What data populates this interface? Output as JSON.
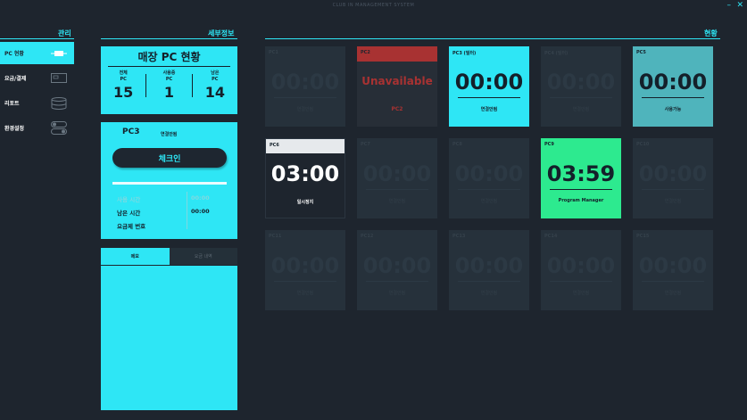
{
  "window": {
    "title": "CLUB IN MANAGEMENT SYSTEM",
    "minimize": "–",
    "close": "✕"
  },
  "sections": {
    "manage": "관리",
    "detail": "세부정보",
    "status": "현황"
  },
  "sidebar": {
    "items": [
      {
        "label": "PC 현황",
        "icon": "monitor-icon",
        "active": true
      },
      {
        "label": "요금/결제",
        "icon": "card-icon",
        "active": false
      },
      {
        "label": "리포트",
        "icon": "database-icon",
        "active": false
      },
      {
        "label": "환경설정",
        "icon": "toggle-icon",
        "active": false
      }
    ]
  },
  "summary": {
    "title": "매장 PC 현황",
    "stats": [
      {
        "label": "전체\nPC",
        "value": "15"
      },
      {
        "label": "사용중\nPC",
        "value": "1"
      },
      {
        "label": "남은\nPC",
        "value": "14"
      }
    ]
  },
  "selected": {
    "name": "PC3",
    "status": "연결안됨",
    "checkin_label": "체크인",
    "progress": 1.0,
    "rows": [
      {
        "label": "사용 시간",
        "value": "00:00"
      },
      {
        "label": "남은 시간",
        "value": "00:00"
      },
      {
        "label": "요금제 번호",
        "value": ""
      }
    ]
  },
  "tabs": [
    {
      "label": "메모",
      "active": true
    },
    {
      "label": "요금 내역",
      "active": false
    }
  ],
  "colors": {
    "accent": "#2ee6f5",
    "background": "#1e252e",
    "unavailable": "#a83232",
    "available": "#4fb4bc",
    "manager": "#2dea8f"
  },
  "pcs": [
    {
      "name": "PC1",
      "time": "00:00",
      "status": "연결안됨",
      "state": "off"
    },
    {
      "name": "PC2",
      "time": "",
      "status": "PC2",
      "state": "unavailable",
      "message": "Unavailable"
    },
    {
      "name": "PC3 (밀터)",
      "time": "00:00",
      "status": "연결안됨",
      "state": "selected"
    },
    {
      "name": "PC4 (밀터)",
      "time": "00:00",
      "status": "연결안됨",
      "state": "off"
    },
    {
      "name": "PC5",
      "time": "00:00",
      "status": "사용가능",
      "state": "available"
    },
    {
      "name": "PC6",
      "time": "03:00",
      "status": "일시정지",
      "state": "paused"
    },
    {
      "name": "PC7",
      "time": "00:00",
      "status": "연결안됨",
      "state": "off"
    },
    {
      "name": "PC8",
      "time": "00:00",
      "status": "연결안됨",
      "state": "off"
    },
    {
      "name": "PC9",
      "time": "03:59",
      "status": "Program Manager",
      "state": "manager"
    },
    {
      "name": "PC10",
      "time": "00:00",
      "status": "연결안됨",
      "state": "off"
    },
    {
      "name": "PC11",
      "time": "00:00",
      "status": "연결안됨",
      "state": "off"
    },
    {
      "name": "PC12",
      "time": "00:00",
      "status": "연결안됨",
      "state": "off"
    },
    {
      "name": "PC13",
      "time": "00:00",
      "status": "연결안됨",
      "state": "off"
    },
    {
      "name": "PC14",
      "time": "00:00",
      "status": "연결안됨",
      "state": "off"
    },
    {
      "name": "PC15",
      "time": "00:00",
      "status": "연결안됨",
      "state": "off"
    }
  ]
}
